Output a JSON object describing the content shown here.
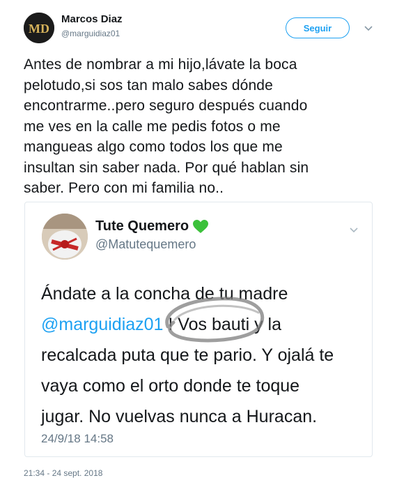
{
  "author": {
    "name": "Marcos Diaz",
    "handle": "@marguidiaz01"
  },
  "follow_label": "Seguir",
  "tweet": {
    "lines": [
      "Antes de nombrar a mi hijo,lávate la boca",
      "pelotudo,si sos tan malo sabes dónde",
      "encontrarme..pero seguro después cuando",
      "me ves en la calle me pedis fotos o me",
      "mangueas algo como todos los que me",
      "insultan sin saber nada. Por qué hablan sin",
      "saber. Pero con mi familia no.."
    ],
    "timestamp": "21:34 - 24 sept. 2018"
  },
  "quoted": {
    "name": "Tute Quemero",
    "handle": "@Matutequemero",
    "line1": "Ándate a la concha de tu madre",
    "mention": "@marguidiaz01",
    "line2_rest": " ! Vos bauti y la",
    "line3": "recalcada puta que te pario. Y ojalá te",
    "line4": "vaya como el orto donde te toque",
    "line5": "jugar. No vuelvas nunca a Huracan.",
    "date": "24/9/18 14:58"
  },
  "icons": {
    "caret": "chevron-down-icon",
    "heart": "green-heart-icon"
  },
  "colors": {
    "accent": "#1da1f2",
    "secondary_text": "#657786",
    "heart": "#3cc13b"
  }
}
